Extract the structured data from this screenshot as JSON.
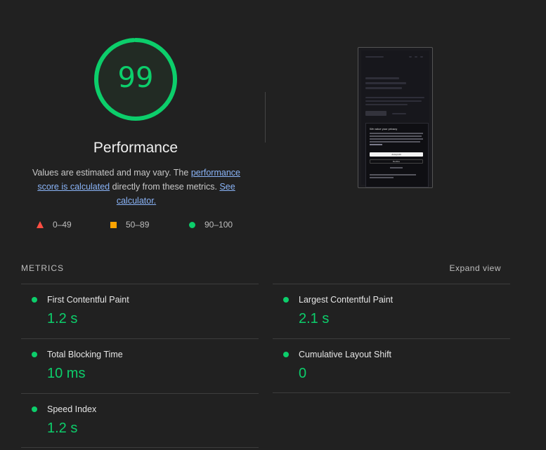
{
  "gauge": {
    "score": "99",
    "score_fraction": 0.99,
    "title": "Performance",
    "color": "#0cce6b"
  },
  "description": {
    "text1": "Values are estimated and may vary. The ",
    "link1": "performance score is calculated",
    "text2": " directly from these metrics. ",
    "link2": "See calculator."
  },
  "legend": [
    {
      "icon": "triangle-fail-icon",
      "label": "0–49",
      "color": "#ff4e42"
    },
    {
      "icon": "square-average-icon",
      "label": "50–89",
      "color": "#ffa400"
    },
    {
      "icon": "circle-pass-icon",
      "label": "90–100",
      "color": "#0cce6b"
    }
  ],
  "thumbnail": {
    "title": "We value your privacy",
    "accept_label": "Accept All",
    "decline_label": "Decline"
  },
  "metrics": {
    "header": "METRICS",
    "expand_label": "Expand view",
    "items": [
      {
        "name": "First Contentful Paint",
        "value": "1.2 s"
      },
      {
        "name": "Largest Contentful Paint",
        "value": "2.1 s"
      },
      {
        "name": "Total Blocking Time",
        "value": "10 ms"
      },
      {
        "name": "Cumulative Layout Shift",
        "value": "0"
      },
      {
        "name": "Speed Index",
        "value": "1.2 s"
      }
    ]
  }
}
